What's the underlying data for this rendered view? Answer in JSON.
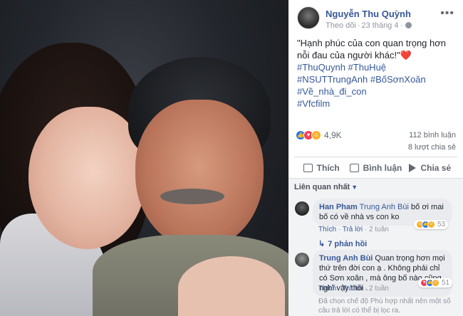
{
  "post": {
    "author": "Nguyễn Thu Quỳnh",
    "follow": "Theo dõi",
    "date": "23 tháng 4",
    "more": "•••",
    "text": "\"Hạnh phúc của con quan trọng hơn nỗi đau của người khác!\"",
    "text_heart": "❤️",
    "hashtags": [
      "#ThuQuynh #ThuHuệ",
      "#NSUTTrungAnh #BốSơnXoăn",
      "#Về_nhà_đi_con",
      "#Vfcfilm"
    ]
  },
  "stats": {
    "reactions": "4,9K",
    "comments": "112 bình luận",
    "shares": "8 lượt chia sẻ"
  },
  "actions": {
    "like": "Thích",
    "comment": "Bình luận",
    "share": "Chia sẻ"
  },
  "comments_section": {
    "sort_label": "Liên quan nhất",
    "comments": [
      {
        "author": "Han Pham",
        "mention": "Trung Anh Bùi",
        "text": "bố ơi mai bố có về nhà vs con ko",
        "like": "Thích",
        "reply": "Trả lời",
        "time": "2 tuần",
        "reaction_count": "53"
      },
      {
        "author": "Trung Anh Bùi",
        "text": "Quan trọng hơn mọi thứ trên đời con ạ . Không phải chỉ có Sơn xoăn , mà ông bố nào cũng nghĩ vậy thôi .",
        "like": "Thích",
        "reply": "Trả lời",
        "time": "2 tuần",
        "reaction_count": "51"
      }
    ],
    "replies_link": "7 phản hồi",
    "filter_note": "Đã chọn chế độ Phù hợp nhất nên một số câu trả lời có thể bị lọc ra."
  },
  "colors": {
    "link_blue": "#365899",
    "like_blue": "#2078f4",
    "love_red": "#f33e58",
    "haha_yellow": "#f7b125"
  }
}
